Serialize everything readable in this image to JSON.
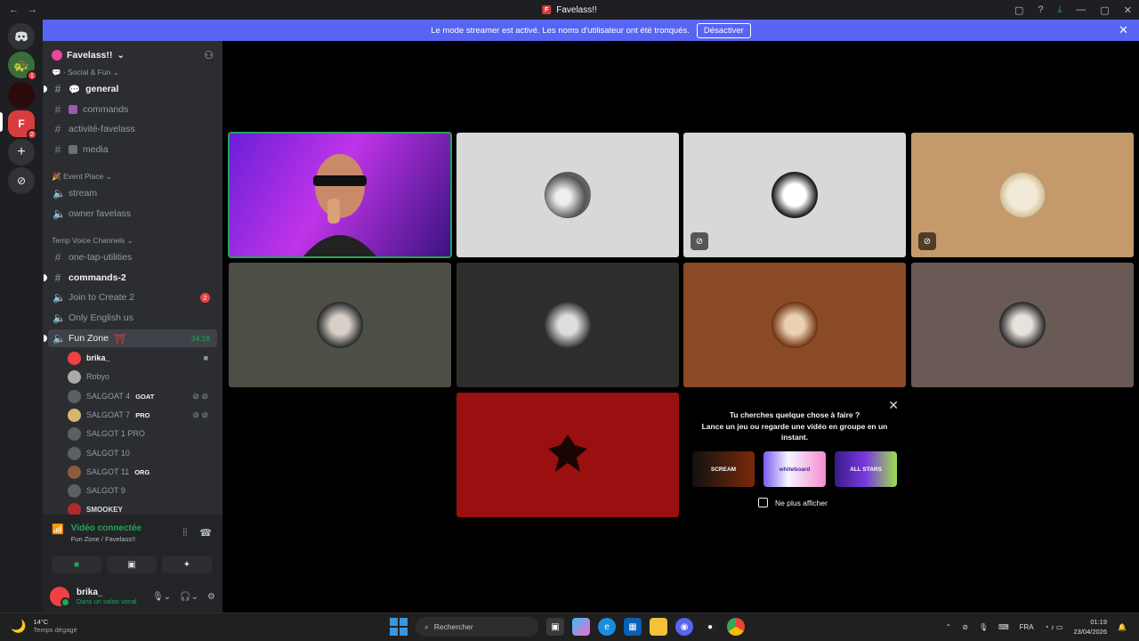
{
  "window": {
    "title": "Favelass!!",
    "back": "←",
    "forward": "→"
  },
  "banner": {
    "text": "Le mode streamer est activé. Les noms d'utilisateur ont été tronqués.",
    "button": "Désactiver"
  },
  "rail": {
    "badges": [
      "1",
      "2"
    ]
  },
  "server": {
    "name": "Favelass!!"
  },
  "categories": {
    "social": "Social & Fun",
    "event": "Event Place",
    "temp": "Temp Voice Channels"
  },
  "channels": {
    "general": "general",
    "commands": "commands",
    "activite": "activité-favelass",
    "media": "media",
    "stream": "stream",
    "owner": "owner favelass",
    "onetap": "one-tap-utilities",
    "commands2": "commands-2",
    "join": "Join to Create 2",
    "join_badge": "2",
    "english": "Only English us",
    "funzone": "Fun Zone",
    "funzone_timer": "34:18"
  },
  "voice_users": [
    {
      "name": "brika_",
      "tag": ""
    },
    {
      "name": "Robyo",
      "tag": ""
    },
    {
      "name": "SALGOAT 4",
      "tag": "GOAT"
    },
    {
      "name": "SALGOAT 7",
      "tag": "PRO"
    },
    {
      "name": "SALGOT 1 PRO",
      "tag": ""
    },
    {
      "name": "SALGOT 10",
      "tag": ""
    },
    {
      "name": "SALGOT 11",
      "tag": "ORG"
    },
    {
      "name": "SALGOT 9",
      "tag": ""
    },
    {
      "name": "SMOOKEY",
      "tag": ""
    }
  ],
  "voice_panel": {
    "status": "Vidéo connectée",
    "location": "Fun Zone",
    "server": "/ Favelass!!"
  },
  "user": {
    "name": "brika_",
    "status": "Dans un salon vocal"
  },
  "activity": {
    "question": "Tu cherches quelque chose à faire ?",
    "prompt": "Lance un jeu ou regarde une vidéo en groupe en un instant.",
    "cards": [
      "SCREAM",
      "whiteboard",
      "ALL STARS"
    ],
    "checkbox": "Ne plus afficher"
  },
  "taskbar": {
    "temp": "14°C",
    "weather": "Temps dégagé",
    "search": "Rechercher",
    "lang": "FRA",
    "time": "01:19",
    "date": "23/04/2026"
  },
  "colors": {
    "accent": "#5865f2",
    "green": "#23a559",
    "red": "#f23f43"
  }
}
